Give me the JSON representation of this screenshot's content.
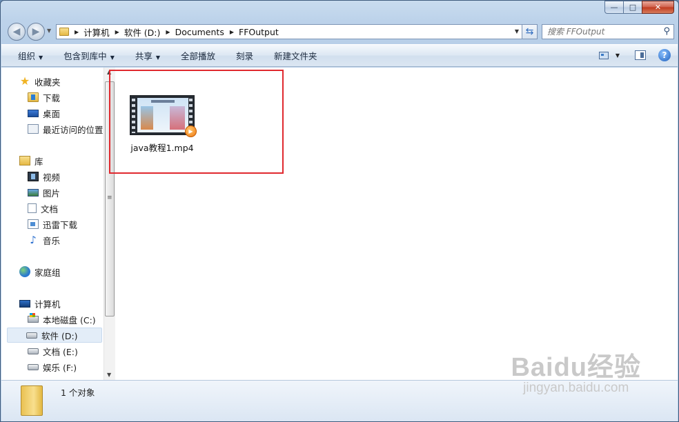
{
  "window": {
    "caption": {
      "minimize": "—",
      "maximize": "□",
      "close": "✕"
    }
  },
  "address": {
    "crumbs": [
      "计算机",
      "软件 (D:)",
      "Documents",
      "FFOutput"
    ]
  },
  "search": {
    "placeholder": "搜索 FFOutput"
  },
  "toolbar": {
    "organize": "组织",
    "include_in_library": "包含到库中",
    "share": "共享",
    "play_all": "全部播放",
    "burn": "刻录",
    "new_folder": "新建文件夹",
    "help": "?"
  },
  "sidebar": {
    "favorites": {
      "label": "收藏夹",
      "items": [
        {
          "label": "下载",
          "icon": "download-folder-icon"
        },
        {
          "label": "桌面",
          "icon": "desktop-icon"
        },
        {
          "label": "最近访问的位置",
          "icon": "recent-places-icon"
        }
      ]
    },
    "libraries": {
      "label": "库",
      "items": [
        {
          "label": "视频",
          "icon": "video-library-icon"
        },
        {
          "label": "图片",
          "icon": "picture-library-icon"
        },
        {
          "label": "文档",
          "icon": "document-library-icon"
        },
        {
          "label": "迅雷下载",
          "icon": "xunlei-icon"
        },
        {
          "label": "音乐",
          "icon": "music-icon"
        }
      ]
    },
    "homegroup": {
      "label": "家庭组"
    },
    "computer": {
      "label": "计算机",
      "items": [
        {
          "label": "本地磁盘 (C:)"
        },
        {
          "label": "软件 (D:)",
          "selected": true
        },
        {
          "label": "文档 (E:)"
        },
        {
          "label": "娱乐 (F:)"
        }
      ]
    }
  },
  "files": [
    {
      "name": "java教程1.mp4",
      "type": "video-file"
    }
  ],
  "details": {
    "count_text": "1 个对象"
  },
  "watermark": {
    "top": "Baidu经验",
    "bottom": "jingyan.baidu.com"
  },
  "colors": {
    "highlight": "#e0282e",
    "accent": "#2b6fcf"
  }
}
